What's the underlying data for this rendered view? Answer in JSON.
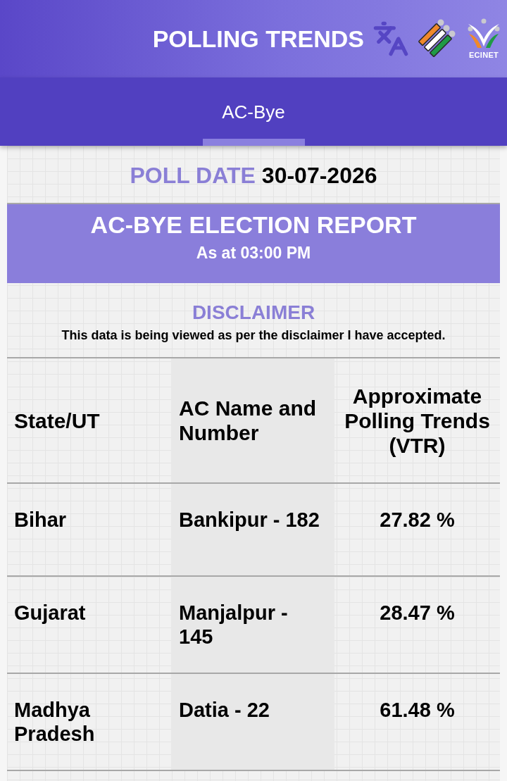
{
  "header": {
    "title": "POLLING TRENDS",
    "logo_caption": "ECINET"
  },
  "tabs": [
    {
      "label": "AC-Bye",
      "selected": true
    }
  ],
  "poll_date": {
    "label": "POLL DATE",
    "value": "30-07-2026"
  },
  "report": {
    "title": "AC-BYE ELECTION REPORT",
    "time": "As at 03:00 PM"
  },
  "disclaimer": {
    "title": "DISCLAIMER",
    "text": "This data is being viewed as per the disclaimer I have accepted."
  },
  "table": {
    "columns": [
      "State/UT",
      "AC Name and Number",
      "Approximate Polling Trends (VTR)"
    ],
    "rows": [
      [
        "Bihar",
        "Bankipur - 182",
        "27.82 %"
      ],
      [
        "Gujarat",
        "Manjalpur - 145",
        "28.47 %"
      ],
      [
        "Madhya Pradesh",
        "Datia - 22",
        "61.48 %"
      ]
    ]
  }
}
